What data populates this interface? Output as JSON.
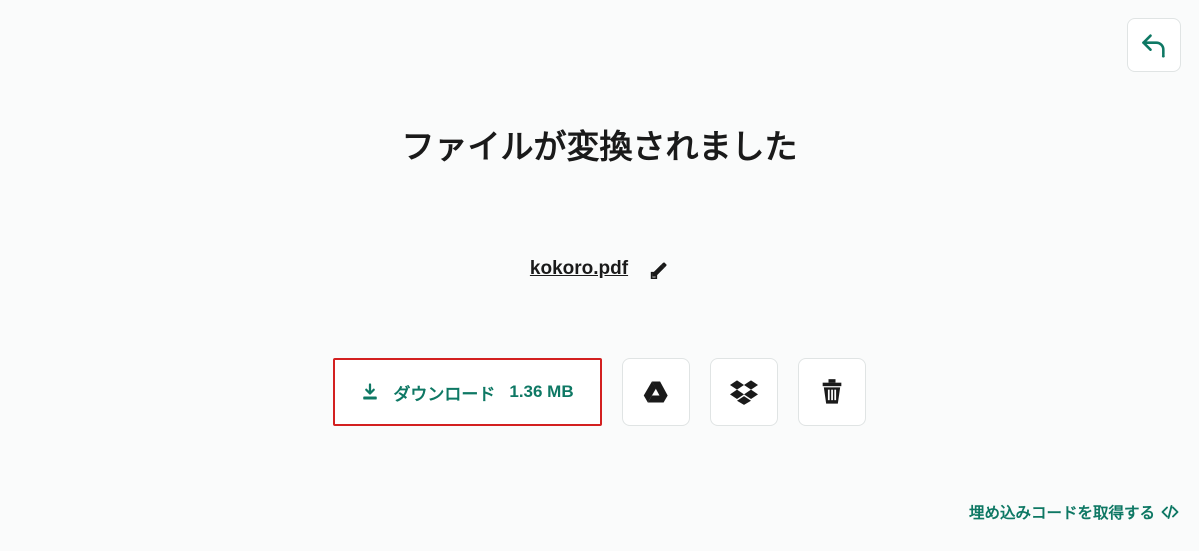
{
  "title": "ファイルが変換されました",
  "file": {
    "name": "kokoro.pdf"
  },
  "download": {
    "label": "ダウンロード",
    "size": "1.36 MB"
  },
  "embed": {
    "label": "埋め込みコードを取得する"
  },
  "colors": {
    "accent": "#0e7864",
    "highlight_border": "#d32020"
  }
}
